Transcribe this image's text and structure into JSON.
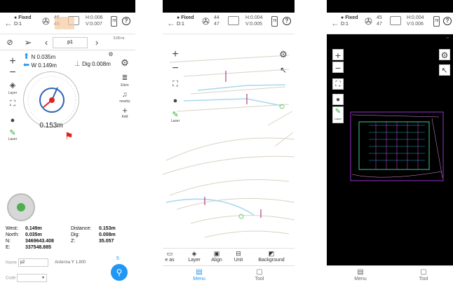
{
  "screen1": {
    "status": {
      "fix": "Fixed",
      "diff": "D:1",
      "sat_top": "46",
      "sat_bottom": "48",
      "h": "H:0.006",
      "v": "V:0.007",
      "battery": "78"
    },
    "nav": {
      "point_name": "p1",
      "scale": "5.00 m"
    },
    "offsets": {
      "north": "N 0.035m",
      "west": "W 0.149m",
      "dig": "Dig 0.008m"
    },
    "left_labels": {
      "layer": "Layer",
      "laser": "Laser"
    },
    "right_labels": {
      "elem": "Elem",
      "nearby": "nearby",
      "add": "Add"
    },
    "distance_big": "0.153m",
    "table": [
      {
        "k": "West:",
        "v": "0.149m",
        "k2": "Distance:",
        "v2": "0.153m"
      },
      {
        "k": "North:",
        "v": "0.035m",
        "k2": "Dig:",
        "v2": "0.008m"
      },
      {
        "k": "N:",
        "v": "3469643.408",
        "k2": "Z:",
        "v2": "35.057"
      },
      {
        "k": "E:",
        "v": "337548.885",
        "k2": "",
        "v2": ""
      }
    ],
    "name_label": "Name",
    "name_value": "p2",
    "antenna_label": "Antenna",
    "antenna_value": "1.800",
    "code_label": "Code",
    "count": "5"
  },
  "screen2": {
    "status": {
      "fix": "Fixed",
      "diff": "D:1",
      "sat_top": "44",
      "sat_bottom": "47",
      "h": "H:0.004",
      "v": "V:0.005",
      "battery": "78"
    },
    "left_labels": {
      "laser": "Laser"
    },
    "tools": [
      "e as",
      "Layer",
      "Align",
      "Unit",
      "Background"
    ],
    "tabs": [
      {
        "label": "Menu",
        "active": true
      },
      {
        "label": "Tool",
        "active": false
      }
    ]
  },
  "screen3": {
    "status": {
      "fix": "Fixed",
      "diff": "D:1",
      "sat_top": "45",
      "sat_bottom": "47",
      "h": "H:0.004",
      "v": "V:0.006",
      "battery": "78"
    },
    "left_labels": {
      "laser": "Laser"
    },
    "tabs": [
      {
        "label": "Menu"
      },
      {
        "label": "Tool"
      }
    ]
  },
  "colors": {
    "accent": "#2196f3",
    "compass_ring": "#2a64b5",
    "target": "#d22222"
  }
}
